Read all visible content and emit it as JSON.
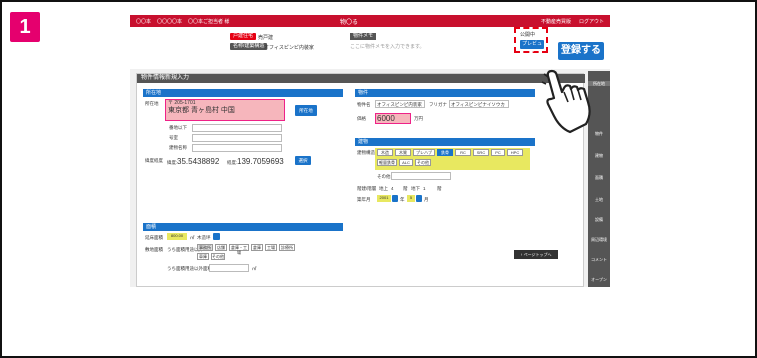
{
  "step": {
    "number": "1"
  },
  "topbar": {
    "left_items": [
      "〇〇本",
      "〇〇〇〇本",
      "〇〇本ご担当者 様"
    ],
    "center": "物〇る",
    "right_items": [
      "不動産売買版",
      "ログアウト"
    ]
  },
  "header": {
    "type_badge": "戸建住宅",
    "type_value": "売戸建",
    "name_badge": "名称/建築構造",
    "name_value": "オフィスピンピ内装家",
    "memo_label": "物件メモ",
    "memo_placeholder": "ここに物件メモを入力できます。",
    "status": "公開中",
    "preview": "プレビュー",
    "register": "登録する"
  },
  "form": {
    "title": "物件情報新規入力",
    "location": {
      "head": "所在地",
      "label": "所在地",
      "zip": "〒 205-1701",
      "address": "東京都 青ヶ島村 中国",
      "map_btn": "所在地",
      "row_labels": [
        "番地以下",
        "号室",
        "建物名称"
      ],
      "latlng_label": "緯度経度",
      "lat_prefix": "緯度:",
      "lat": "35.5438892",
      "lng_prefix": "経度:",
      "lng": "139.7059693",
      "select_btn": "選択"
    },
    "property": {
      "head": "物件",
      "name_label": "物件名",
      "name_value": "オフィスピンピ内装家",
      "kana_label": "フリガナ",
      "kana_value": "オフィスピンピナイソウカ",
      "price_label": "価格",
      "price_value": "6000",
      "price_unit": "万円"
    },
    "building": {
      "head": "建物",
      "structure_label": "建物構造",
      "chips_row1": [
        "木造",
        "木質",
        "プレハブ",
        "鉄骨",
        "RC",
        "SRC",
        "PC",
        "HPC"
      ],
      "chips_row2": [
        "軽量鉄骨",
        "ALC",
        "その他"
      ],
      "other_label": "その他",
      "floors_label": "階建/階層",
      "above": "地上",
      "above_val": "4",
      "floor_unit": "階",
      "below": "地下",
      "below_val": "1",
      "below_unit": "階",
      "built_label": "築年月",
      "built_year": "2001",
      "year_unit": "年",
      "built_month": "5",
      "month_unit": "月"
    },
    "land": {
      "head": "面積",
      "area_label": "延床面積",
      "area_value": "800.00",
      "area_unit": "㎡",
      "area_note": "木造坪",
      "area2_label": "敷地面積",
      "use_label": "うち面積用途以外",
      "chips": [
        "事務所",
        "店舗",
        "倉庫・工場",
        "倉庫",
        "工場",
        "診療所"
      ],
      "chips2": [
        "車庫",
        "その他"
      ],
      "other_area_label": "うち面積用途以外面積",
      "other_unit": "㎡"
    },
    "page_top": "↑ ページトップへ"
  },
  "sidebar": [
    "所在地",
    "物件",
    "建物",
    "面積",
    "土地",
    "設備",
    "周辺環境",
    "コメント",
    "オープン"
  ],
  "colors": {
    "brand_red": "#c8102e",
    "accent_blue": "#1a73c9",
    "step_pink": "#e5006e"
  }
}
